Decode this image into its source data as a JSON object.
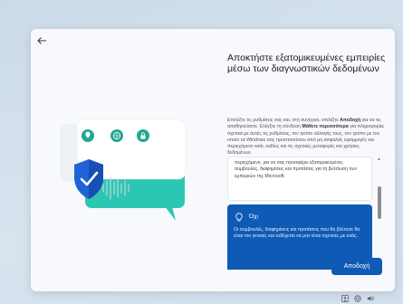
{
  "window": {
    "back_icon": "back-arrow-icon",
    "title": "Αποκτήστε εξατομικευμένες εμπειρίες μέσω των διαγνωστικών δεδομένων",
    "description": {
      "part1": "Επιλέξτε τις ρυθμίσεις σας και, στη συνέχεια, επιλέξτε ",
      "accept_word": "Αποδοχή",
      "part2": " για να τις αποθηκεύσετε. Ελέγξτε τη σύνδεση ",
      "learn_word": "Μάθετε περισσότερα",
      "part3": " για πληροφορίες σχετικά με αυτές τις ρυθμίσεις, τον τρόπο αλλαγής τους, τον τρόπο με τον οποίο τα Windows σας προστατεύουν από μη ασφαλείς εφαρμογές και περιεχόμενο web, καθώς και τις σχετικές μεταφορές και χρήσεις δεδομένων."
    },
    "options": {
      "yes_text": "περιεχόμενο, για να σας προσφέρει εξατομικευμένες συμβουλές, διαφημίσεις και προτάσεις για τη βελτίωση των εμπειριών της Microsoft.",
      "no_label": "Όχι",
      "no_text": "Οι συμβουλές, διαφημίσεις και προτάσεις που θα βλέπετε θα είναι πιο γενικές και ενδέχεται να μην είναι σχετικές με εσάς."
    },
    "buttons": {
      "learn_more": "Μάθετε περισσότερα",
      "accept": "Αποδοχή"
    }
  },
  "illustration": {
    "icons": [
      "location-pin-icon",
      "globe-icon",
      "lock-icon",
      "shield-check-icon",
      "soundwave-icon",
      "chat-bubble-icon"
    ]
  },
  "taskbar": {
    "icons": [
      "accessibility-icon",
      "network-icon",
      "volume-icon"
    ]
  },
  "colors": {
    "accent": "#0f5ab5",
    "teal": "#2cc7b2",
    "shield_blue": "#1f63d6"
  }
}
